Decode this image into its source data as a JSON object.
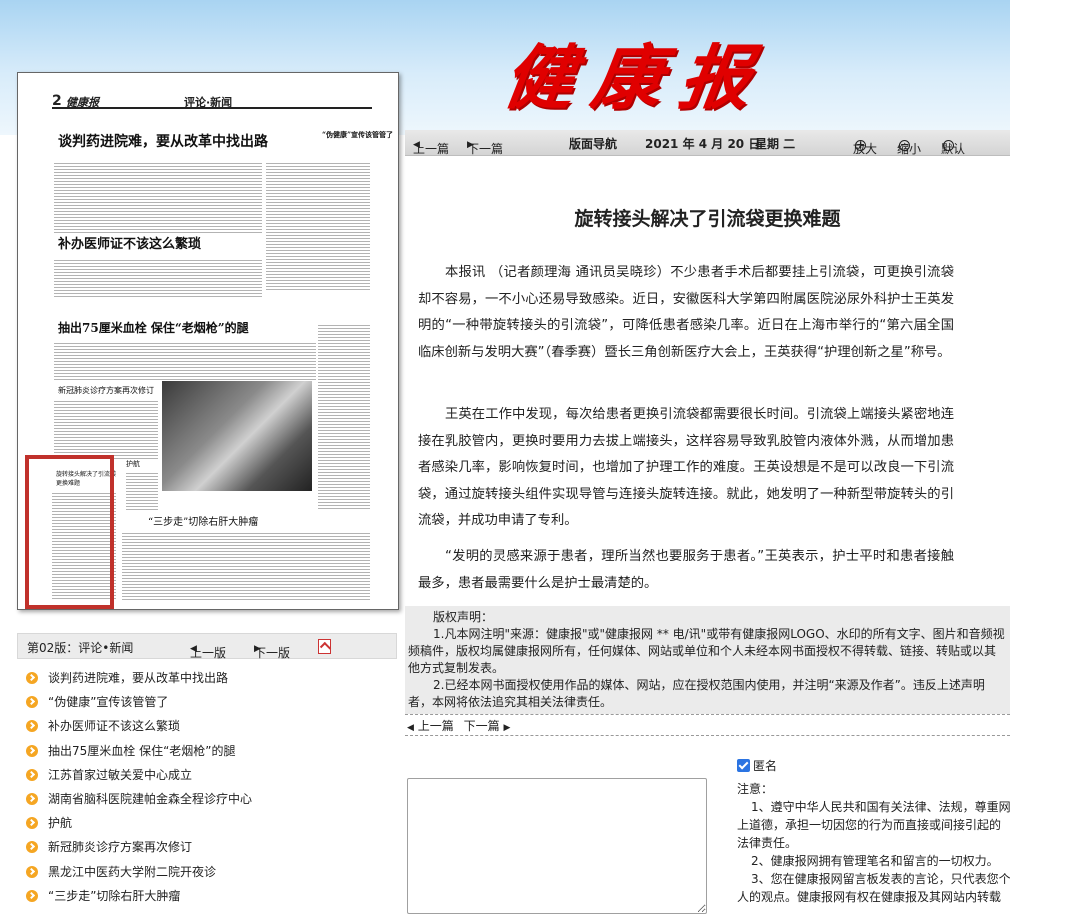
{
  "masthead": "健康报",
  "nav": {
    "prev": "上一篇",
    "next": "下一篇",
    "layout_nav": "版面导航",
    "date": "2021 年 4 月 20 日",
    "weekday": "星期 二",
    "zoom_in": "放大",
    "zoom_out": "缩小",
    "default": "默认"
  },
  "thumbnail": {
    "page_no": "2",
    "logo": "健康报",
    "section": "评论·新闻",
    "headlines": [
      "谈判药进院难，要从改革中找出路",
      "补办医师证不该这么繁琐",
      "抽出75厘米血栓  保住“老烟枪”的腿",
      "新冠肺炎诊疗方案再次修订",
      "“三步走”切除右肝大肿瘤",
      "“伪健康”宣传该管管了",
      "旋转接头解决了引流袋更换难题",
      "护航"
    ]
  },
  "page_bar": {
    "label": "第02版：评论•新闻",
    "prev": "上一版",
    "next": "下一版"
  },
  "articles": [
    "谈判药进院难，要从改革中找出路",
    "“伪健康”宣传该管管了",
    "补办医师证不该这么繁琐",
    "抽出75厘米血栓 保住“老烟枪”的腿",
    "江苏首家过敏关爱中心成立",
    "湖南省脑科医院建帕金森全程诊疗中心",
    "护航",
    "新冠肺炎诊疗方案再次修订",
    "黑龙江中医药大学附二院开夜诊",
    "“三步走”切除右肝大肿瘤"
  ],
  "article": {
    "title": "旋转接头解决了引流袋更换难题",
    "paragraphs": [
      "本报讯 （记者颜理海 通讯员吴晓珍）不少患者手术后都要挂上引流袋，可更换引流袋却不容易，一不小心还易导致感染。近日，安徽医科大学第四附属医院泌尿外科护士王英发明的“一种带旋转接头的引流袋”，可降低患者感染几率。近日在上海市举行的“第六届全国临床创新与发明大赛”（春季赛）暨长三角创新医疗大会上，王英获得“护理创新之星”称号。",
      "王英在工作中发现，每次给患者更换引流袋都需要很长时间。引流袋上端接头紧密地连接在乳胶管内，更换时要用力去拔上端接头，这样容易导致乳胶管内液体外溅，从而增加患者感染几率，影响恢复时间，也增加了护理工作的难度。王英设想是不是可以改良一下引流袋，通过旋转接头组件实现导管与连接头旋转连接。就此，她发明了一种新型带旋转头的引流袋，并成功申请了专利。",
      "“发明的灵感来源于患者，理所当然也要服务于患者。”王英表示，护士平时和患者接触最多，患者最需要什么是护士最清楚的。"
    ]
  },
  "copyright": {
    "heading": "版权声明：",
    "item1": "1.凡本网注明\"来源：健康报\"或\"健康报网 ** 电/讯\"或带有健康报网LOGO、水印的所有文字、图片和音频视频稿件，版权均属健康报网所有，任何媒体、网站或单位和个人未经本网书面授权不得转载、链接、转贴或以其他方式复制发表。",
    "item2": "2.已经本网书面授权使用作品的媒体、网站，应在授权范围内使用，并注明“来源及作者”。违反上述声明者，本网将依法追究其相关法律责任。"
  },
  "comment": {
    "anonymous_label": "匿名",
    "notes_heading": "注意：",
    "note1": "1、遵守中华人民共和国有关法律、法规，尊重网上道德，承担一切因您的行为而直接或间接引起的法律责任。",
    "note2": "2、健康报网拥有管理笔名和留言的一切权力。",
    "note3": "3、您在健康报网留言板发表的言论，只代表您个人的观点。健康报网有权在健康报及其网站内转载"
  }
}
